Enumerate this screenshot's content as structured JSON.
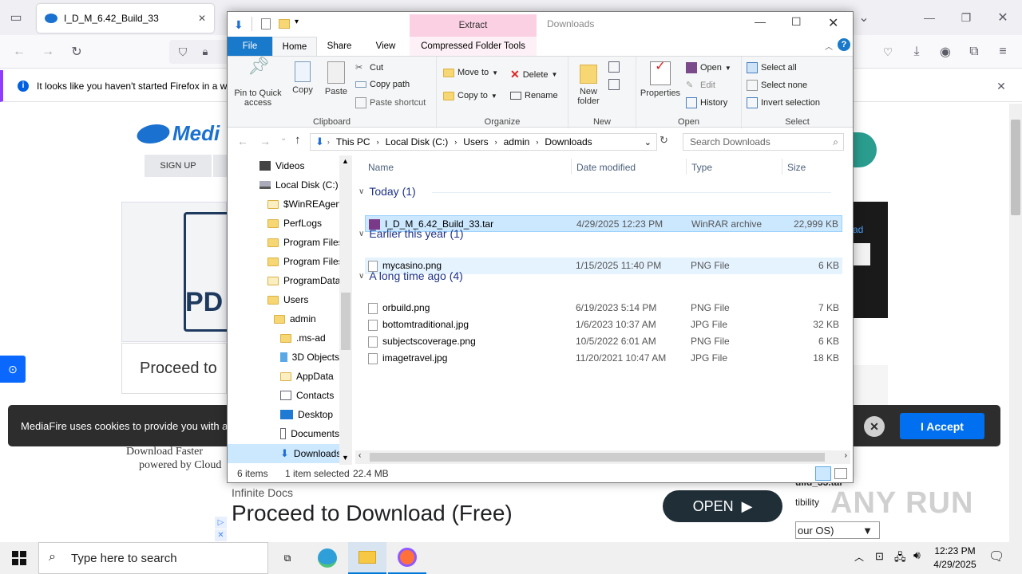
{
  "firefox": {
    "tab_title": "I_D_M_6.42_Build_33",
    "notice_text": "It looks like you haven't started Firefox in a wh",
    "close_symbol": "✕"
  },
  "page": {
    "logo_text": "Medi",
    "signup_label": "SIGN UP",
    "pdf_label": "PD",
    "proceed_left": "Proceed to",
    "download_faster": "Download Faster",
    "powered_by": "powered by Cloud",
    "cookie_text": "MediaFire uses cookies to provide you with a",
    "cookie_accept": "I Accept",
    "ad_brand": "Infinite Docs",
    "ad_title": "Proceed to Download (Free)",
    "ad_open": "OPEN",
    "right_filename": "uild_33.tar",
    "right_compat": "tibility",
    "right_os": "our OS)",
    "right_label_d": "ad",
    "watermark": "ANY RUN"
  },
  "explorer": {
    "title": "Downloads",
    "context_tab": "Extract",
    "tabs": {
      "file": "File",
      "home": "Home",
      "share": "Share",
      "view": "View",
      "tools": "Compressed Folder Tools"
    },
    "ribbon": {
      "clipboard": {
        "label": "Clipboard",
        "pin": "Pin to Quick access",
        "copy": "Copy",
        "paste": "Paste",
        "cut": "Cut",
        "copy_path": "Copy path",
        "paste_shortcut": "Paste shortcut"
      },
      "organize": {
        "label": "Organize",
        "move_to": "Move to",
        "copy_to": "Copy to",
        "delete": "Delete",
        "rename": "Rename"
      },
      "new": {
        "label": "New",
        "new_folder": "New folder"
      },
      "open": {
        "label": "Open",
        "properties": "Properties",
        "open": "Open",
        "edit": "Edit",
        "history": "History"
      },
      "select": {
        "label": "Select",
        "select_all": "Select all",
        "select_none": "Select none",
        "invert": "Invert selection"
      }
    },
    "address": [
      "This PC",
      "Local Disk (C:)",
      "Users",
      "admin",
      "Downloads"
    ],
    "search_placeholder": "Search Downloads",
    "nav": [
      "Videos",
      "Local Disk (C:)",
      "$WinREAgent",
      "PerfLogs",
      "Program Files",
      "Program Files",
      "ProgramData",
      "Users",
      "admin",
      ".ms-ad",
      "3D Objects",
      "AppData",
      "Contacts",
      "Desktop",
      "Documents",
      "Downloads"
    ],
    "columns": {
      "name": "Name",
      "date": "Date modified",
      "type": "Type",
      "size": "Size"
    },
    "groups": {
      "today": "Today (1)",
      "earlier": "Earlier this year (1)",
      "long_ago": "A long time ago (4)"
    },
    "files": [
      {
        "name": "I_D_M_6.42_Build_33.tar",
        "date": "4/29/2025 12:23 PM",
        "type": "WinRAR archive",
        "size": "22,999 KB"
      },
      {
        "name": "mycasino.png",
        "date": "1/15/2025 11:40 PM",
        "type": "PNG File",
        "size": "6 KB"
      },
      {
        "name": "orbuild.png",
        "date": "6/19/2023 5:14 PM",
        "type": "PNG File",
        "size": "7 KB"
      },
      {
        "name": "bottomtraditional.jpg",
        "date": "1/6/2023 10:37 AM",
        "type": "JPG File",
        "size": "32 KB"
      },
      {
        "name": "subjectscoverage.png",
        "date": "10/5/2022 6:01 AM",
        "type": "PNG File",
        "size": "6 KB"
      },
      {
        "name": "imagetravel.jpg",
        "date": "11/20/2021 10:47 AM",
        "type": "JPG File",
        "size": "18 KB"
      }
    ],
    "status": {
      "items": "6 items",
      "selected": "1 item selected",
      "size": "22.4 MB"
    }
  },
  "taskbar": {
    "search_placeholder": "Type here to search",
    "time": "12:23 PM",
    "date": "4/29/2025"
  },
  "colors": {
    "selection": "#cce8ff",
    "accent": "#0078d7",
    "mf_blue": "#1b71cf"
  }
}
